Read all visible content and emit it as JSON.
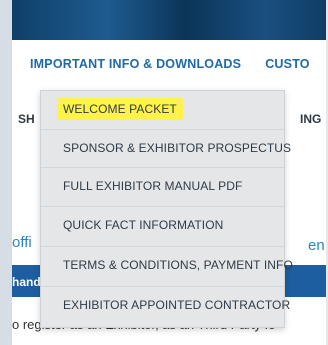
{
  "nav": {
    "primary": [
      {
        "label": "IMPORTANT INFO & DOWNLOADS"
      },
      {
        "label": "CUSTO"
      }
    ],
    "secondary": {
      "left": "SH",
      "right": "ING"
    }
  },
  "dropdown": {
    "items": [
      {
        "label": "WELCOME PACKET"
      },
      {
        "label": "SPONSOR & EXHIBITOR PROSPECTUS"
      },
      {
        "label": "FULL EXHIBITOR MANUAL PDF"
      },
      {
        "label": "QUICK FACT INFORMATION"
      },
      {
        "label": "TERMS & CONDITIONS, PAYMENT INFO"
      },
      {
        "label": "EXHIBITOR APPOINTED CONTRACTOR"
      }
    ]
  },
  "snippets": {
    "left_blue_text": "hand",
    "left_blue_heading": "offi",
    "right_blue_heading": "en"
  },
  "footer": {
    "text": "o register as an Exhibitor, as an Third Party fo"
  }
}
